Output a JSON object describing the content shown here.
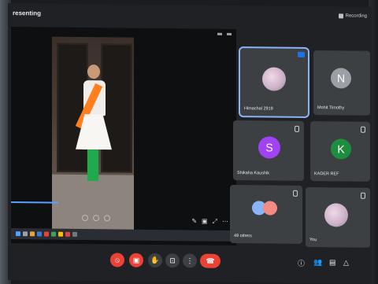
{
  "window": {
    "title": "resenting",
    "recording_label": "Recording"
  },
  "presentation": {
    "toolbar_icons": [
      "pencil-icon",
      "layout-icon",
      "expand-icon",
      "more-icon"
    ]
  },
  "participants": [
    {
      "name": "Himachal 2919",
      "avatar_type": "photo",
      "active": true
    },
    {
      "name": "Mohit Timothy",
      "avatar_letter": "N",
      "avatar_color": "#9aa0a6"
    },
    {
      "name": "Shikaha Kaushik",
      "avatar_letter": "S",
      "avatar_color": "#a142f4"
    },
    {
      "name": "KADER REF",
      "avatar_letter": "K",
      "avatar_color": "#1e8e3e"
    },
    {
      "name": "49 others",
      "avatar_type": "group"
    },
    {
      "name": "You",
      "avatar_type": "photo"
    }
  ],
  "controls": {
    "mic_icon": "mic-off-icon",
    "camera_icon": "camera-off-icon",
    "hand_icon": "raise-hand-icon",
    "present_icon": "present-icon",
    "more_icon": "more-vert-icon",
    "end_icon": "end-call-icon"
  },
  "colors": {
    "accent_red": "#ea4335",
    "tile_bg": "#3c4043",
    "bg": "#202124",
    "active_outline": "#8ab4f8"
  }
}
